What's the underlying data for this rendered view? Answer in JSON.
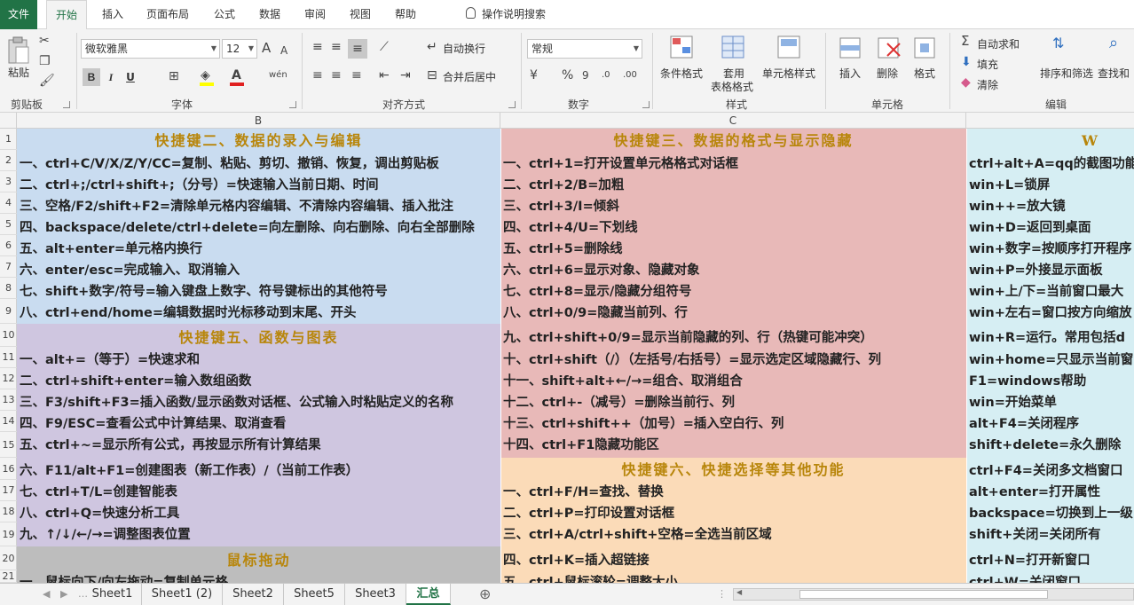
{
  "ribbon_tabs": [
    "文件",
    "开始",
    "插入",
    "页面布局",
    "公式",
    "数据",
    "审阅",
    "视图",
    "帮助",
    "操作说明搜索"
  ],
  "clipboard": {
    "paste": "粘贴",
    "label": "剪贴板"
  },
  "font": {
    "name": "微软雅黑",
    "size": "12",
    "grow": "A",
    "shrink": "A",
    "bold": "B",
    "italic": "I",
    "underline": "U",
    "color_a": "A",
    "phonetic": "wén",
    "label": "字体"
  },
  "alignment": {
    "wrap": "自动换行",
    "merge": "合并后居中",
    "label": "对齐方式"
  },
  "number": {
    "format": "常规",
    "percent": "%",
    "comma": "9",
    "label": "数字"
  },
  "styles": {
    "conditional": "条件格式",
    "table1": "套用",
    "table2": "表格格式",
    "cell_styles": "单元格样式",
    "label": "样式"
  },
  "cells": {
    "insert": "插入",
    "delete": "删除",
    "format": "格式",
    "label": "单元格"
  },
  "editing": {
    "autosum": "自动求和",
    "fill": "填充",
    "clear": "清除",
    "sort": "排序和筛选",
    "find": "查找和",
    "label": "编辑"
  },
  "columns": [
    "B",
    "C"
  ],
  "rows": [
    "1",
    "2",
    "3",
    "4",
    "5",
    "6",
    "7",
    "8",
    "9",
    "10",
    "11",
    "12",
    "13",
    "14",
    "15",
    "16",
    "17",
    "18",
    "19",
    "20",
    "21"
  ],
  "colB": {
    "h1": "快捷键二、数据的录入与编辑",
    "b1": [
      "一、ctrl+C/V/X/Z/Y/CC=复制、粘贴、剪切、撤销、恢复，调出剪贴板",
      "二、ctrl+;/ctrl+shift+;（分号）=快速输入当前日期、时间",
      "三、空格/F2/shift+F2=清除单元格内容编辑、不清除内容编辑、插入批注",
      "四、backspace/delete/ctrl+delete=向左删除、向右删除、向右全部删除",
      "五、alt+enter=单元格内换行",
      "六、enter/esc=完成输入、取消输入",
      "七、shift+数字/符号=输入键盘上数字、符号键标出的其他符号",
      "八、ctrl+end/home=编辑数据时光标移动到末尾、开头"
    ],
    "h2": "快捷键五、函数与图表",
    "b2": [
      "一、alt+=（等于）=快速求和",
      "二、ctrl+shift+enter=输入数组函数",
      "三、F3/shift+F3=插入函数/显示函数对话框、公式输入时粘贴定义的名称",
      "四、F9/ESC=查看公式中计算结果、取消查看",
      "五、ctrl+~=显示所有公式，再按显示所有计算结果",
      "六、F11/alt+F1=创建图表（新工作表）/（当前工作表）",
      "七、ctrl+T/L=创建智能表",
      "八、ctrl+Q=快速分析工具",
      "九、↑/↓/←/→=调整图表位置"
    ],
    "h3": "鼠标拖动",
    "b3": [
      "一、鼠标向下/向左拖动=复制单元格"
    ]
  },
  "colC": {
    "h1": "快捷键三、数据的格式与显示隐藏",
    "b1": [
      "一、ctrl+1=打开设置单元格格式对话框",
      "二、ctrl+2/B=加粗",
      "三、ctrl+3/I=倾斜",
      "四、ctrl+4/U=下划线",
      "五、ctrl+5=删除线",
      "六、ctrl+6=显示对象、隐藏对象",
      "七、ctrl+8=显示/隐藏分组符号",
      "八、ctrl+0/9=隐藏当前列、行",
      "九、ctrl+shift+0/9=显示当前隐藏的列、行（热键可能冲突）",
      "十、ctrl+shift（/）（左括号/右括号）=显示选定区域隐藏行、列",
      "十一、shift+alt+←/→=组合、取消组合",
      "十二、ctrl+-（减号）=删除当前行、列",
      "十三、ctrl+shift++（加号）=插入空白行、列",
      "十四、ctrl+F1隐藏功能区"
    ],
    "h2": "快捷键六、快捷选择等其他功能",
    "b2": [
      "一、ctrl+F/H=查找、替换",
      "二、ctrl+P=打印设置对话框",
      "三、ctrl+A/ctrl+shift+空格=全选当前区域",
      "四、ctrl+K=插入超链接",
      "五、ctrl+鼠标滚轮=调整大小"
    ]
  },
  "colD": {
    "h1": "W",
    "b1": [
      "ctrl+alt+A=qq的截图功能",
      "win+L=锁屏",
      "win++=放大镜",
      "win+D=返回到桌面",
      "win+数字=按顺序打开程序",
      "win+P=外接显示面板",
      "win+上/下=当前窗口最大",
      "win+左右=窗口按方向缩放",
      "win+R=运行。常用包括d",
      "win+home=只显示当前窗",
      "F1=windows帮助",
      "win=开始菜单",
      "alt+F4=关闭程序",
      "shift+delete=永久删除",
      "ctrl+F4=关闭多文档窗口",
      "alt+enter=打开属性",
      "backspace=切换到上一级",
      "shift+关闭=关闭所有",
      "ctrl+N=打开新窗口",
      "ctrl+W=关闭窗口"
    ]
  },
  "sheets": [
    "Sheet1",
    "Sheet1 (2)",
    "Sheet2",
    "Sheet5",
    "Sheet3",
    "汇总"
  ],
  "colors": {
    "blue": "#c9dcf0",
    "purple": "#cfc6e0",
    "pink": "#e8b9b8",
    "peach": "#fbdbb8",
    "gray": "#bdbdbd",
    "cyan": "#d6eef3",
    "header_gold": "#b8860b",
    "excel_green": "#217346"
  }
}
